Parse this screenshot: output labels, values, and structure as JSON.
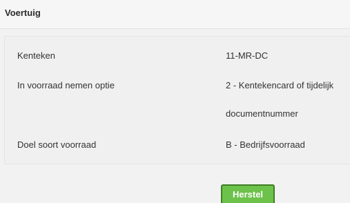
{
  "section": {
    "title": "Voertuig"
  },
  "rows": [
    {
      "label": "Kenteken",
      "value": "11-MR-DC"
    },
    {
      "label": "In voorraad nemen optie",
      "value": "2 - Kentekencard of tijdelijk",
      "value_cont": "documentnummer"
    },
    {
      "label": "Doel soort voorraad",
      "value": "B - Bedrijfsvoorraad"
    }
  ],
  "actions": {
    "restore_label": "Herstel"
  },
  "colors": {
    "button_bg": "#6cc24a",
    "button_border": "#3f7d26"
  }
}
